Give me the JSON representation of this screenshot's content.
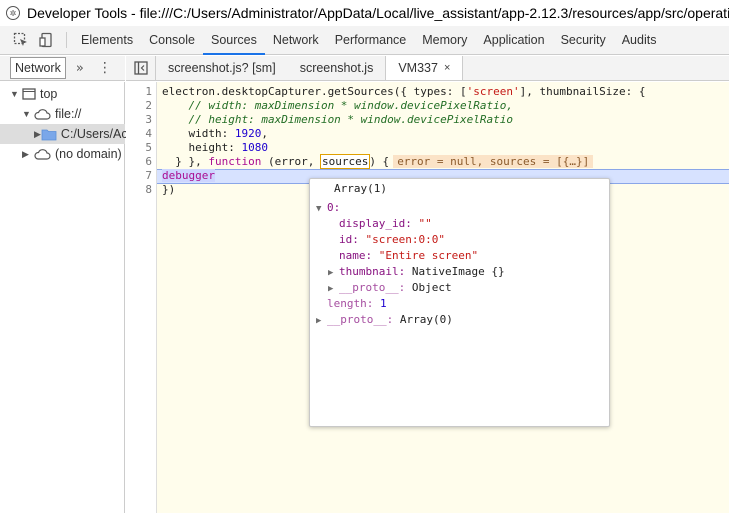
{
  "window": {
    "title": "Developer Tools - file:///C:/Users/Administrator/AppData/Local/live_assistant/app-2.12.3/resources/app/src/operational/i"
  },
  "toolbar": {
    "tabs": [
      "Elements",
      "Console",
      "Sources",
      "Network",
      "Performance",
      "Memory",
      "Application",
      "Security",
      "Audits"
    ],
    "active_tab": "Sources"
  },
  "navigator": {
    "tab_label": "Network",
    "more_label": "»",
    "menu_label": "⋮",
    "tree": {
      "top": "top",
      "file": "file://",
      "folder": "C:/Users/Ac",
      "no_domain": "(no domain)"
    }
  },
  "source_tabs": {
    "tabs": [
      "screenshot.js? [sm]",
      "screenshot.js",
      "VM337"
    ],
    "active_tab": "VM337",
    "close_label": "×"
  },
  "editor": {
    "line_numbers": [
      "1",
      "2",
      "3",
      "4",
      "5",
      "6",
      "7",
      "8"
    ],
    "line1": {
      "a": "electron.desktopCapturer.getSources({ types: [",
      "b": "'screen'",
      "c": "], thumbnailSize: {"
    },
    "line2": "    // width: maxDimension * window.devicePixelRatio,",
    "line3": "    // height: maxDimension * window.devicePixelRatio",
    "line4": {
      "a": "    width: ",
      "b": "1920",
      "c": ","
    },
    "line5": {
      "a": "    height: ",
      "b": "1080"
    },
    "line6": {
      "a": "  } }, ",
      "b": "function",
      "c": " (error, ",
      "d": "sources",
      "e": ") {",
      "inline": "error = null, sources = [{…}]"
    },
    "line7": "debugger",
    "line8": "})"
  },
  "popover": {
    "title": "Array(1)",
    "index_key": "0:",
    "display_id_key": "display_id:",
    "display_id_val": "\"\"",
    "id_key": "id:",
    "id_val": "\"screen:0:0\"",
    "name_key": "name:",
    "name_val": "\"Entire screen\"",
    "thumbnail_key": "thumbnail:",
    "thumbnail_val": "NativeImage {}",
    "proto_key": "__proto__:",
    "proto_val": "Object",
    "length_key": "length:",
    "length_val": "1",
    "arr_proto_key": "__proto__:",
    "arr_proto_val": "Array(0)"
  },
  "colors": {
    "accent": "#1a73e8",
    "editor_bg": "#fffdec",
    "exec_line": "#d7e2ff"
  }
}
